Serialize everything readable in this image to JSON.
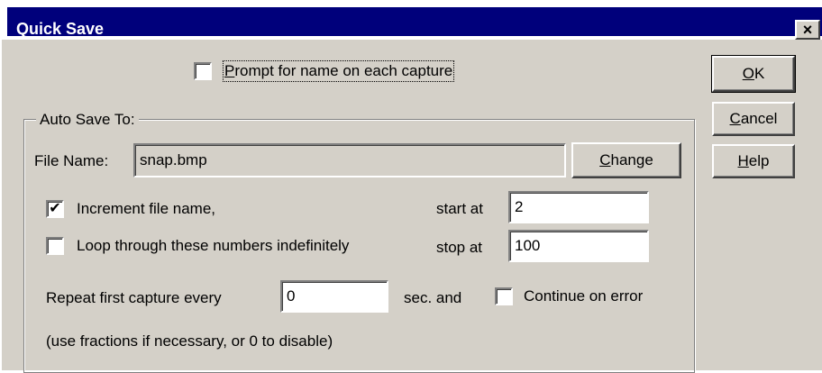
{
  "window": {
    "title": "Quick Save",
    "close_glyph": "×"
  },
  "buttons": {
    "ok": {
      "mnemonic": "O",
      "rest": "K"
    },
    "cancel": {
      "mnemonic": "C",
      "rest": "ancel"
    },
    "help": {
      "mnemonic": "H",
      "rest": "elp"
    },
    "change": {
      "mnemonic": "C",
      "rest": "hange"
    }
  },
  "prompt": {
    "label_mnemonic": "P",
    "label_rest": "rompt for name on each capture",
    "checked": false,
    "mark": ""
  },
  "group": {
    "title": "Auto Save To:"
  },
  "file_name": {
    "label": "File Name:",
    "value": "snap.bmp"
  },
  "increment": {
    "label": "Increment file name,",
    "checked": true,
    "mark": "✔"
  },
  "loop": {
    "label": "Loop through these numbers indefinitely",
    "checked": false,
    "mark": ""
  },
  "start_at": {
    "label": "start at",
    "value": "2"
  },
  "stop_at": {
    "label": "stop at",
    "value": "100"
  },
  "repeat": {
    "label": "Repeat first capture every",
    "value": "0",
    "suffix": "sec. and"
  },
  "continue_on_error": {
    "label": "Continue on error",
    "checked": false,
    "mark": ""
  },
  "hint": "(use fractions if necessary, or 0 to disable)"
}
